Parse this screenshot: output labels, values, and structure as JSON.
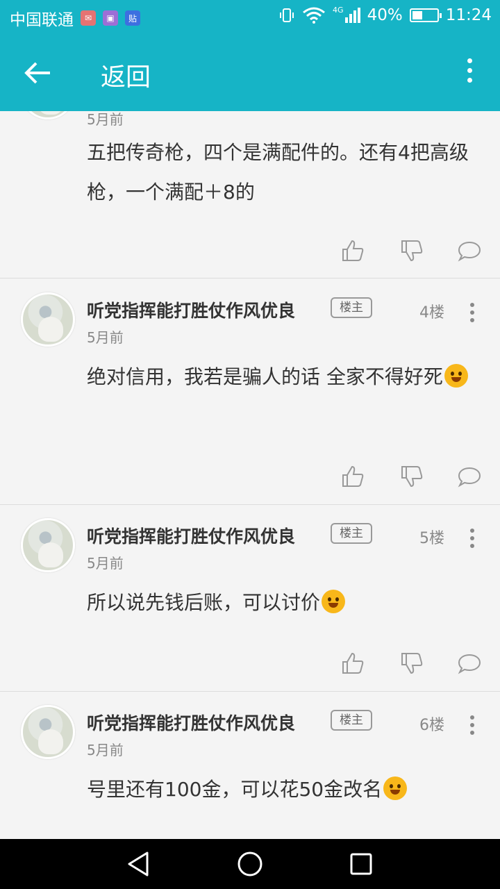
{
  "status_bar": {
    "carrier": "中国联通",
    "apps": [
      {
        "icon": "mail-app-icon",
        "color": "#e57373",
        "glyph": "✉"
      },
      {
        "icon": "gallery-app-icon",
        "color": "#9c6fd6",
        "glyph": "▣"
      },
      {
        "icon": "tieba-app-icon",
        "color": "#3d6fe0",
        "glyph": "贴"
      }
    ],
    "network": "4G",
    "battery": "40%",
    "battery_level": 0.4,
    "time": "11:24"
  },
  "toolbar": {
    "title": "返回"
  },
  "colors": {
    "accent": "#16b4c6"
  },
  "posts": [
    {
      "time": "5月前",
      "content": "五把传奇枪，四个是满配件的。还有4把高级枪，一个满配＋8的"
    },
    {
      "author": "听党指挥能打胜仗作风优良",
      "badge": "楼主",
      "floor": "4楼",
      "time": "5月前",
      "content": "绝对信用，我若是骗人的话 全家不得好死"
    },
    {
      "author": "听党指挥能打胜仗作风优良",
      "badge": "楼主",
      "floor": "5楼",
      "time": "5月前",
      "content": "所以说先钱后账，可以讨价"
    },
    {
      "author": "听党指挥能打胜仗作风优良",
      "badge": "楼主",
      "floor": "6楼",
      "time": "5月前",
      "content": "号里还有100金，可以花50金改名"
    }
  ]
}
